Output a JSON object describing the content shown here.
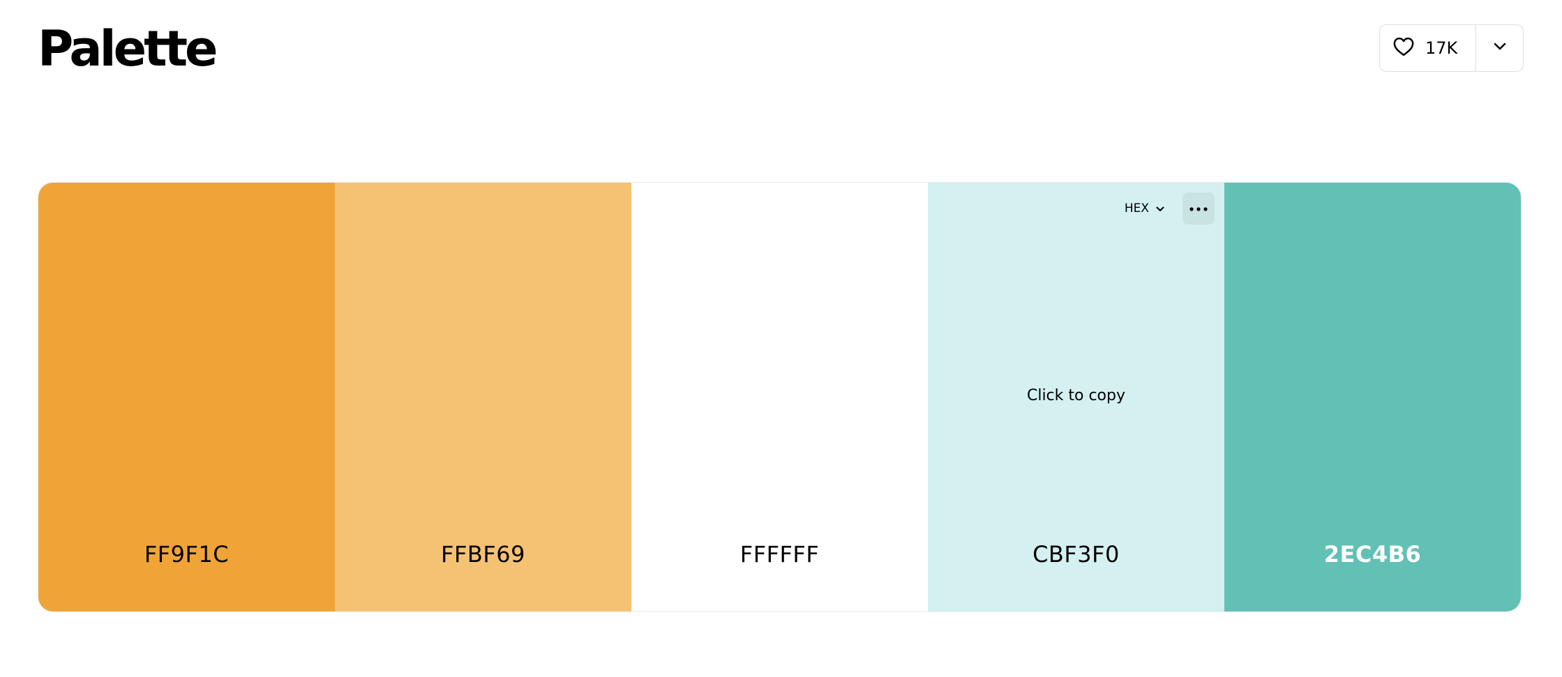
{
  "header": {
    "title": "Palette",
    "like_count": "17K",
    "icons": {
      "like": "heart-icon",
      "more": "chevron-down-icon"
    }
  },
  "palette": {
    "swatches": [
      {
        "code": "FF9F1C",
        "color": "#f0a437",
        "text_color": "#000000"
      },
      {
        "code": "FFBF69",
        "color": "#f4c272",
        "text_color": "#000000"
      },
      {
        "code": "FFFFFF",
        "color": "#ffffff",
        "text_color": "#000000"
      },
      {
        "code": "CBF3F0",
        "color": "#d4f0f0",
        "text_color": "#000000",
        "hover_hint": "Click to copy",
        "format": "HEX"
      },
      {
        "code": "2EC4B6",
        "color": "#63c0b5",
        "text_color": "#ffffff"
      }
    ],
    "icons": {
      "format_dropdown": "chevron-down-icon",
      "menu": "ellipsis-icon"
    }
  }
}
